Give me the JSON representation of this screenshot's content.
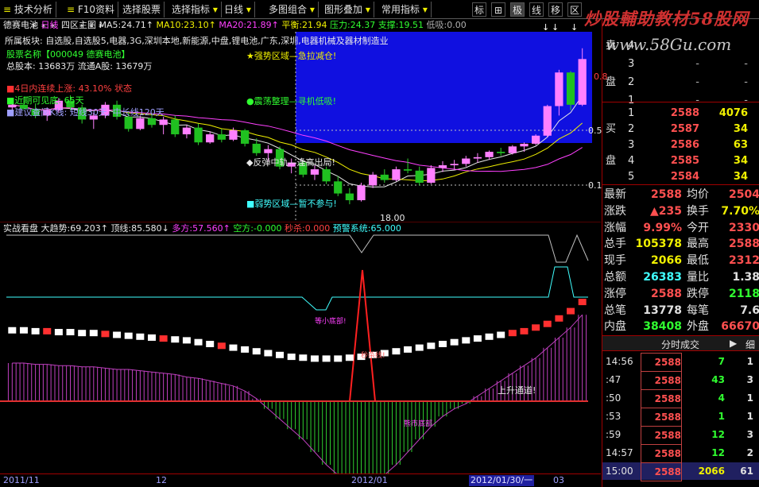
{
  "toolbar": {
    "items": [
      "技术分析",
      "F10资料",
      "选择股票",
      "选择指标",
      "日线",
      "多图组合",
      "图形叠加",
      "常用指标"
    ],
    "icons": [
      "标",
      "⊞",
      "极",
      "线",
      "移",
      "区"
    ]
  },
  "watermark": {
    "text": "炒股輔助教材58股网",
    "url": "www.58Gu.com"
  },
  "main_header": {
    "stock": "德赛电池",
    "period": "日线",
    "layout": "四区主图",
    "ma5_label": "MA5:",
    "ma5": "24.71↑",
    "ma10_label": "MA10:",
    "ma10": "23.10↑",
    "ma20_label": "MA20:",
    "ma20": "21.89↑",
    "balance_label": "平衡:",
    "balance": "21.94",
    "pressure_label": "压力:",
    "pressure": "24.37",
    "support_label": "支撑:",
    "support": "19.51",
    "low_label": "低吸:",
    "low": "0.00"
  },
  "info": {
    "sector": "所属板块: 自选股,自选股5,电器,3G,深圳本地,新能源,中盘,锂电池,广东,深圳,电器机械及器材制造业",
    "code": "股票名称【000049 德赛电池】",
    "shares": "总股本: 13683万  流通A股: 13679万",
    "stat1": "4日内连续上涨: 43.10% 状态",
    "stat2": "近期可见底: 65天",
    "stat3": "建议查阅K线: 短线30天, 中长线120天"
  },
  "zones": {
    "strong": "★强势区域—急拉减仓!",
    "consolidate": "●震荡整理—寻机低吸!",
    "rebound": "◆反弹中轨—逢高出局!",
    "weak": "■弱势区域—暂不参与!"
  },
  "chart_labels": {
    "low_marker": "18.00",
    "right_scale": [
      "0.5",
      "0.1"
    ],
    "right_high": "0.8"
  },
  "indicator": {
    "name": "实战看盘",
    "trend_label": "大趋势:",
    "trend": "69.203↑",
    "top_label": "顶线:",
    "top": "85.580↓",
    "bull_label": "多方:",
    "bull": "57.560↑",
    "bear_label": "空方:",
    "bear": "-0.000",
    "kill_label": "秒杀:",
    "kill": "0.000",
    "warn_label": "预警系统:",
    "warn": "65.000",
    "annotations": {
      "bottom": "等小底部!",
      "kill_signal": "秒杀线!",
      "uptrend": "上升通道!",
      "bear_market": "熊市底部"
    }
  },
  "dates": [
    "2011/11",
    "12",
    "2012/01",
    "2012/01/30/一",
    "03"
  ],
  "orderbook": {
    "sell_side": "卖",
    "sell_side2": "盘",
    "buy_side": "买",
    "buy_side2": "盘",
    "asks": [
      {
        "lvl": "5",
        "price": "",
        "vol": ""
      },
      {
        "lvl": "4",
        "price": "",
        "vol": ""
      },
      {
        "lvl": "3",
        "price": "-",
        "vol": "-"
      },
      {
        "lvl": "2",
        "price": "-",
        "vol": "-"
      },
      {
        "lvl": "1",
        "price": "-",
        "vol": "-"
      }
    ],
    "bids": [
      {
        "lvl": "1",
        "price": "2588",
        "vol": "4076"
      },
      {
        "lvl": "2",
        "price": "2587",
        "vol": "34"
      },
      {
        "lvl": "3",
        "price": "2586",
        "vol": "63"
      },
      {
        "lvl": "4",
        "price": "2585",
        "vol": "34"
      },
      {
        "lvl": "5",
        "price": "2584",
        "vol": "34"
      }
    ]
  },
  "quote": [
    {
      "l1": "最新",
      "v1": "2588",
      "c1": "#ff5050",
      "l2": "均价",
      "v2": "2504",
      "c2": "#ff5050"
    },
    {
      "l1": "涨跌",
      "v1": "▲235",
      "c1": "#ff5050",
      "l2": "换手",
      "v2": "7.70%",
      "c2": "#f0f000"
    },
    {
      "l1": "涨幅",
      "v1": "9.99%",
      "c1": "#ff5050",
      "l2": "今开",
      "v2": "2330",
      "c2": "#ff5050"
    },
    {
      "l1": "总手",
      "v1": "105378",
      "c1": "#f0f000",
      "l2": "最高",
      "v2": "2588",
      "c2": "#ff5050"
    },
    {
      "l1": "现手",
      "v1": "2066",
      "c1": "#f0f000",
      "l2": "最低",
      "v2": "2312",
      "c2": "#ff5050"
    },
    {
      "l1": "总额",
      "v1": "26383",
      "c1": "#40ffff",
      "l2": "量比",
      "v2": "1.38",
      "c2": "#e0e0e0"
    },
    {
      "l1": "涨停",
      "v1": "2588",
      "c1": "#ff5050",
      "l2": "跌停",
      "v2": "2118",
      "c2": "#30ff30"
    },
    {
      "l1": "总笔",
      "v1": "13778",
      "c1": "#e0e0e0",
      "l2": "每笔",
      "v2": "7.6",
      "c2": "#e0e0e0"
    },
    {
      "l1": "内盘",
      "v1": "38408",
      "c1": "#30ff30",
      "l2": "外盘",
      "v2": "66670",
      "c2": "#ff5050"
    }
  ],
  "ticks_header": {
    "title": "分时成交",
    "next": "▶",
    "detail": "细"
  },
  "ticks": [
    {
      "t": "14:56",
      "p": "2588",
      "v": "7",
      "n": "1",
      "vc": "#30ff30"
    },
    {
      "t": ":47",
      "p": "2588",
      "v": "43",
      "n": "3",
      "vc": "#30ff30"
    },
    {
      "t": ":50",
      "p": "2588",
      "v": "4",
      "n": "1",
      "vc": "#30ff30"
    },
    {
      "t": ":53",
      "p": "2588",
      "v": "1",
      "n": "1",
      "vc": "#30ff30"
    },
    {
      "t": ":59",
      "p": "2588",
      "v": "12",
      "n": "3",
      "vc": "#30ff30"
    },
    {
      "t": "14:57",
      "p": "2588",
      "v": "12",
      "n": "2",
      "vc": "#30ff30"
    },
    {
      "t": "15:00",
      "p": "2588",
      "v": "2066",
      "n": "61",
      "vc": "#f0f000"
    }
  ],
  "chart_data": [
    {
      "type": "candlestick",
      "title": "德赛电池 日线",
      "ylim": [
        17,
        30
      ],
      "candles": [
        [
          25.2,
          25.8,
          24.9,
          25.4
        ],
        [
          25.4,
          26.0,
          25.0,
          25.1
        ],
        [
          25.1,
          25.5,
          24.4,
          24.6
        ],
        [
          24.6,
          25.2,
          24.2,
          25.0
        ],
        [
          25.0,
          25.9,
          24.8,
          25.7
        ],
        [
          25.7,
          26.1,
          25.0,
          25.2
        ],
        [
          25.2,
          25.4,
          24.0,
          24.3
        ],
        [
          24.3,
          24.8,
          23.6,
          24.6
        ],
        [
          24.6,
          25.6,
          24.4,
          25.4
        ],
        [
          25.4,
          25.7,
          24.3,
          24.5
        ],
        [
          24.5,
          24.9,
          23.4,
          23.6
        ],
        [
          23.6,
          24.6,
          23.5,
          24.4
        ],
        [
          24.4,
          24.8,
          23.7,
          23.9
        ],
        [
          23.9,
          24.5,
          23.2,
          24.3
        ],
        [
          24.3,
          24.6,
          23.0,
          23.2
        ],
        [
          23.2,
          23.9,
          22.9,
          23.7
        ],
        [
          23.7,
          24.0,
          22.4,
          22.6
        ],
        [
          22.6,
          23.4,
          22.5,
          23.2
        ],
        [
          23.2,
          23.6,
          22.6,
          22.8
        ],
        [
          22.8,
          23.7,
          22.7,
          23.5
        ],
        [
          23.5,
          23.6,
          22.3,
          22.5
        ],
        [
          22.5,
          22.9,
          21.6,
          21.8
        ],
        [
          21.8,
          22.4,
          21.2,
          22.1
        ],
        [
          22.1,
          22.3,
          20.6,
          20.8
        ],
        [
          20.8,
          21.4,
          20.3,
          21.1
        ],
        [
          21.1,
          21.2,
          20.0,
          20.2
        ],
        [
          20.2,
          20.9,
          19.8,
          20.6
        ],
        [
          20.6,
          20.8,
          19.5,
          19.7
        ],
        [
          19.7,
          20.1,
          18.6,
          18.8
        ],
        [
          18.8,
          19.2,
          18.0,
          18.3
        ],
        [
          18.3,
          19.6,
          18.2,
          19.4
        ],
        [
          19.4,
          20.4,
          19.2,
          20.2
        ],
        [
          20.2,
          20.6,
          19.6,
          19.8
        ],
        [
          19.8,
          20.8,
          19.7,
          20.6
        ],
        [
          20.6,
          21.4,
          20.3,
          20.5
        ],
        [
          20.5,
          20.8,
          19.4,
          19.6
        ],
        [
          19.6,
          20.9,
          19.5,
          20.7
        ],
        [
          20.7,
          21.2,
          20.4,
          20.9
        ],
        [
          20.9,
          21.3,
          20.6,
          21.0
        ],
        [
          21.0,
          21.6,
          20.8,
          21.4
        ],
        [
          21.4,
          21.8,
          21.1,
          21.5
        ],
        [
          21.5,
          22.0,
          21.3,
          21.9
        ],
        [
          21.9,
          22.2,
          21.6,
          21.8
        ],
        [
          21.8,
          22.4,
          21.7,
          22.3
        ],
        [
          22.3,
          22.6,
          21.9,
          22.5
        ],
        [
          22.5,
          23.2,
          22.4,
          23.1
        ],
        [
          23.1,
          25.4,
          23.0,
          25.3
        ],
        [
          25.3,
          28.0,
          24.6,
          27.8
        ],
        [
          27.8,
          27.9,
          25.0,
          25.4
        ],
        [
          25.4,
          29.6,
          25.3,
          28.8
        ]
      ]
    },
    {
      "type": "bar",
      "title": "实战看盘",
      "ylim": [
        -100,
        110
      ],
      "values": [
        30,
        30,
        29,
        29,
        28,
        28,
        27,
        27,
        26,
        25,
        25,
        24,
        23,
        22,
        21,
        19,
        18,
        16,
        14,
        12,
        8,
        2,
        -6,
        -14,
        -22,
        -30,
        -40,
        -50,
        -58,
        -62,
        -64,
        -62,
        -58,
        -50,
        -40,
        -30,
        -20,
        -12,
        -6,
        -2,
        4,
        10,
        16,
        22,
        28,
        34,
        42,
        50,
        58,
        68
      ],
      "line": [
        25,
        25,
        24,
        24,
        23,
        23,
        22,
        22,
        21,
        20,
        19,
        18,
        17,
        16,
        15,
        14,
        12,
        10,
        8,
        6,
        4,
        2,
        0,
        -2,
        -4,
        -5,
        -6,
        -6,
        -6,
        -5,
        -4,
        -2,
        0,
        2,
        4,
        6,
        8,
        10,
        12,
        14,
        16,
        18,
        20,
        22,
        24,
        28,
        32,
        38,
        46,
        56
      ]
    }
  ]
}
